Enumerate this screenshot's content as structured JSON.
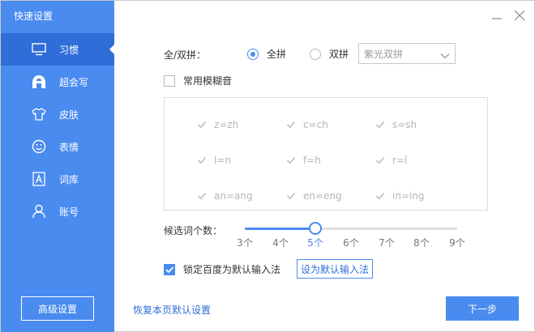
{
  "window": {
    "title": "快速设置"
  },
  "sidebar": {
    "items": [
      {
        "label": "习惯",
        "icon": "monitor-icon",
        "active": true
      },
      {
        "label": "超会写",
        "icon": "pen-logo-icon",
        "active": false
      },
      {
        "label": "皮肤",
        "icon": "tshirt-icon",
        "active": false
      },
      {
        "label": "表情",
        "icon": "smiley-icon",
        "active": false
      },
      {
        "label": "词库",
        "icon": "letter-a-icon",
        "active": false
      },
      {
        "label": "账号",
        "icon": "person-icon",
        "active": false
      }
    ],
    "advanced_label": "高级设置"
  },
  "pinyin": {
    "label": "全/双拼：",
    "full_label": "全拼",
    "double_label": "双拼",
    "selected": "全拼",
    "scheme_value": "紫光双拼"
  },
  "fuzzy": {
    "label": "常用模糊音",
    "enabled": false,
    "items": [
      "z=zh",
      "c=ch",
      "s=sh",
      "l=n",
      "f=h",
      "r=l",
      "an=ang",
      "en=eng",
      "in=ing"
    ]
  },
  "candidates": {
    "label": "候选词个数：",
    "ticks": [
      "3个",
      "4个",
      "5个",
      "6个",
      "7个",
      "8个",
      "9个"
    ],
    "value": 5,
    "min": 3,
    "max": 9
  },
  "lock": {
    "label": "锁定百度为默认输入法",
    "checked": true,
    "set_default_label": "设为默认输入法"
  },
  "footer": {
    "restore_label": "恢复本页默认设置",
    "next_label": "下一步"
  },
  "colors": {
    "accent": "#4a8bf0",
    "sidebar_active": "#2f6ed8"
  }
}
